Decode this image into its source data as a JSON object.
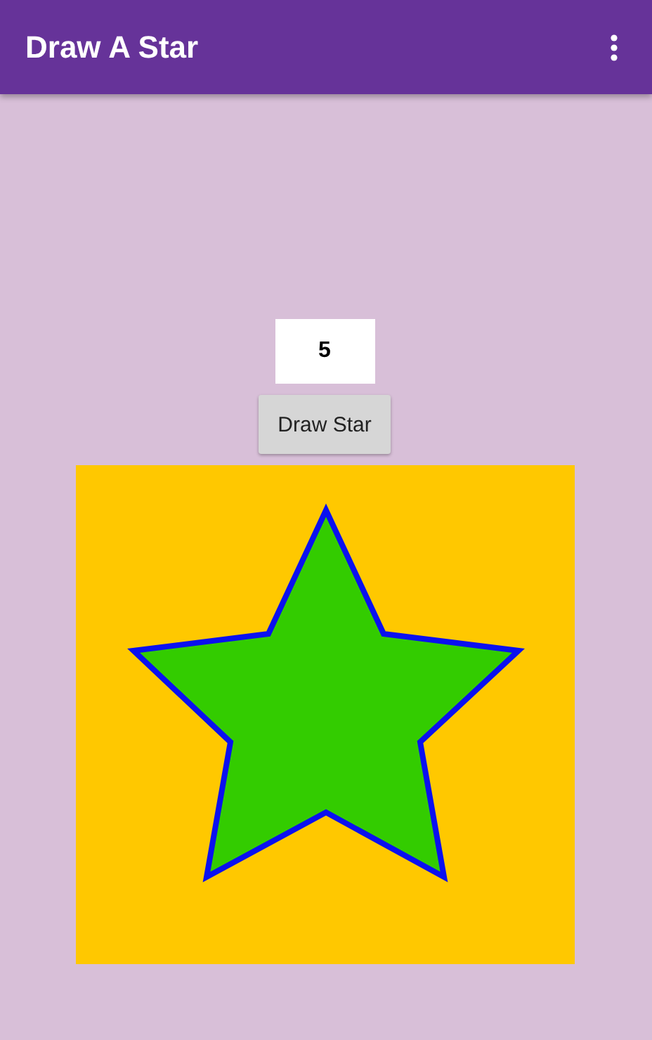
{
  "app_bar": {
    "title": "Draw A Star"
  },
  "points_field": {
    "value": "5"
  },
  "draw_button": {
    "label": "Draw Star"
  }
}
